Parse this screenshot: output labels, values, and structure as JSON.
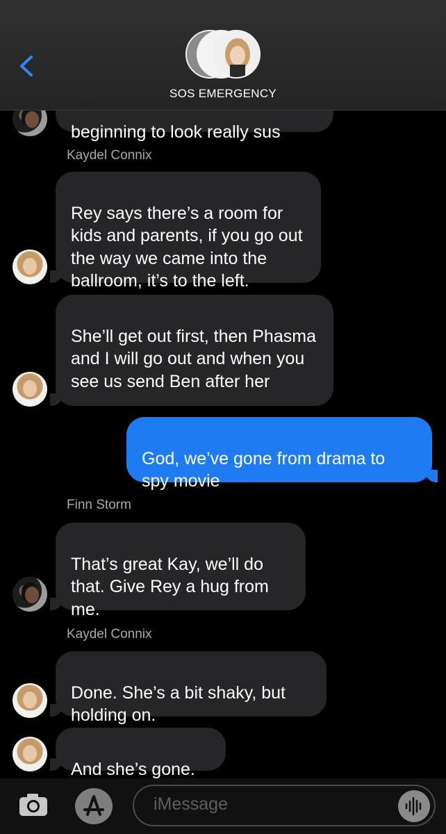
{
  "header": {
    "back_icon": "chevron-left-icon",
    "title": "SOS EMERGENCY"
  },
  "messages": [
    {
      "type": "incoming",
      "text": "beginning to look really sus"
    },
    {
      "type": "sender",
      "name": "Kaydel Connix"
    },
    {
      "type": "incoming",
      "text": "Rey says there’s a room for kids and parents, if you go out the way we came into the ballroom, it’s to the left."
    },
    {
      "type": "incoming",
      "text": "She’ll get out first, then Phasma and I will go out and when you see us send Ben after her"
    },
    {
      "type": "outgoing",
      "text": "God, we’ve gone from drama to spy movie"
    },
    {
      "type": "sender",
      "name": "Finn Storm"
    },
    {
      "type": "incoming",
      "text": "That’s great Kay, we’ll do that. Give Rey a hug from me."
    },
    {
      "type": "sender",
      "name": "Kaydel Connix"
    },
    {
      "type": "incoming",
      "text": "Done. She’s a bit shaky, but holding on."
    },
    {
      "type": "incoming",
      "text": "And she’s gone."
    }
  ],
  "composer": {
    "placeholder": "iMessage",
    "camera_icon": "camera-icon",
    "apps_icon": "app-store-icon",
    "audio_icon": "audio-waveform-icon"
  },
  "colors": {
    "incoming_bubble": "#262628",
    "outgoing_bubble": "#1f7bf2",
    "accent": "#1f7bf2",
    "background": "#000000"
  }
}
